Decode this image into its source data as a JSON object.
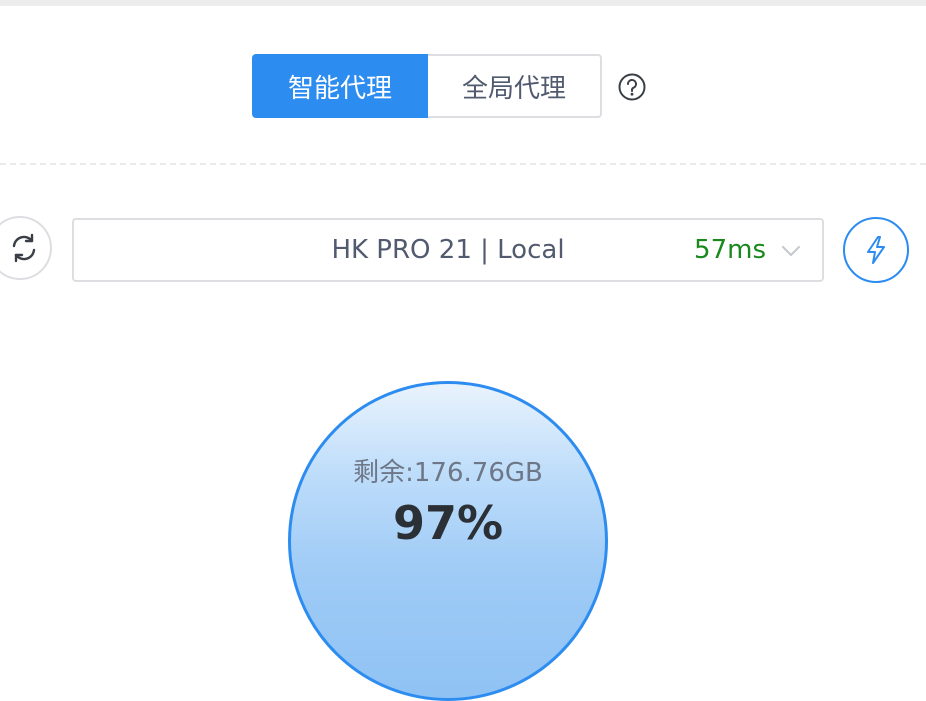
{
  "proxy_mode": {
    "options": [
      {
        "label": "智能代理",
        "selected": true
      },
      {
        "label": "全局代理",
        "selected": false
      }
    ],
    "help_icon": "question-circle-icon"
  },
  "server": {
    "name": "HK PRO 21 | Local",
    "latency": "57ms",
    "refresh_icon": "refresh-icon",
    "dropdown_icon": "chevron-down-icon",
    "boost_icon": "lightning-icon"
  },
  "traffic": {
    "remaining": "剩余:176.76GB",
    "percent": "97%"
  },
  "colors": {
    "accent": "#2d8cf0",
    "latency_good": "#19891e",
    "border": "#dcdee2"
  }
}
